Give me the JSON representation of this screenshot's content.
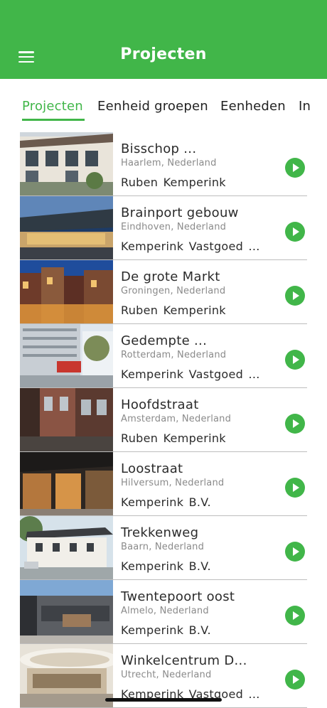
{
  "header": {
    "title": "Projecten",
    "menu_icon": "hamburger-menu-icon"
  },
  "colors": {
    "primary": "#41b649",
    "text": "#2b2b2b",
    "subtext": "#8a8a8a",
    "divider": "#bdbdbd"
  },
  "tabs": [
    {
      "label": "Projecten",
      "active": true
    },
    {
      "label": "Eenheid groepen",
      "active": false
    },
    {
      "label": "Eenheden",
      "active": false
    },
    {
      "label": "In",
      "active": false
    }
  ],
  "projects": [
    {
      "name": "Bisschop ...",
      "location": "Haarlem, Nederland",
      "owner": "Ruben  Kemperink",
      "action_icon": "play-icon"
    },
    {
      "name": "Brainport gebouw",
      "location": "Eindhoven, Nederland",
      "owner": "Kemperink Vastgoed ...",
      "action_icon": "play-icon"
    },
    {
      "name": "De grote Markt",
      "location": "Groningen, Nederland",
      "owner": "Ruben  Kemperink",
      "action_icon": "play-icon"
    },
    {
      "name": "Gedempte ...",
      "location": "Rotterdam, Nederland",
      "owner": "Kemperink Vastgoed ...",
      "action_icon": "play-icon"
    },
    {
      "name": "Hoofdstraat",
      "location": "Amsterdam, Nederland",
      "owner": "Ruben  Kemperink",
      "action_icon": "play-icon"
    },
    {
      "name": "Loostraat",
      "location": "Hilversum, Nederland",
      "owner": "Kemperink B.V.",
      "action_icon": "play-icon"
    },
    {
      "name": "Trekkenweg",
      "location": "Baarn, Nederland",
      "owner": "Kemperink B.V.",
      "action_icon": "play-icon"
    },
    {
      "name": "Twentepoort oost",
      "location": "Almelo, Nederland",
      "owner": "Kemperink B.V.",
      "action_icon": "play-icon"
    },
    {
      "name": "Winkelcentrum D...",
      "location": "Utrecht, Nederland",
      "owner": "Kemperink Vastgoed ...",
      "action_icon": "play-icon"
    }
  ]
}
